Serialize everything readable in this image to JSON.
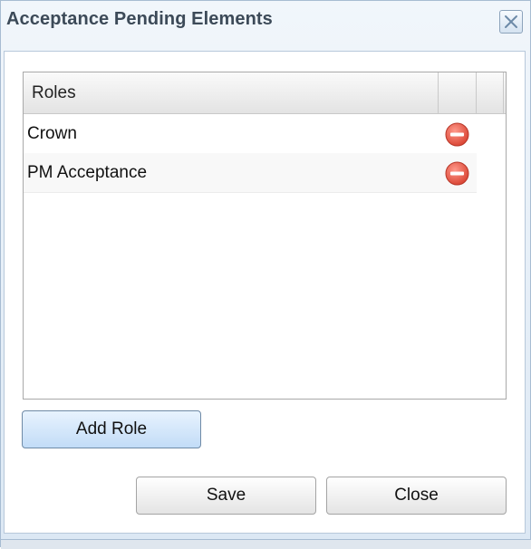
{
  "dialog": {
    "title": "Acceptance Pending Elements",
    "close_icon": "close-x-icon"
  },
  "grid": {
    "column_header": "Roles",
    "rows": [
      {
        "label": "Crown",
        "action_icon": "remove-icon"
      },
      {
        "label": "PM Acceptance",
        "action_icon": "remove-icon"
      }
    ]
  },
  "buttons": {
    "add_role": "Add Role",
    "save": "Save",
    "close": "Close"
  },
  "colors": {
    "remove_icon": "#e05a4e",
    "title_text": "#3c4a58",
    "primary_button": "#c2dcf7"
  }
}
